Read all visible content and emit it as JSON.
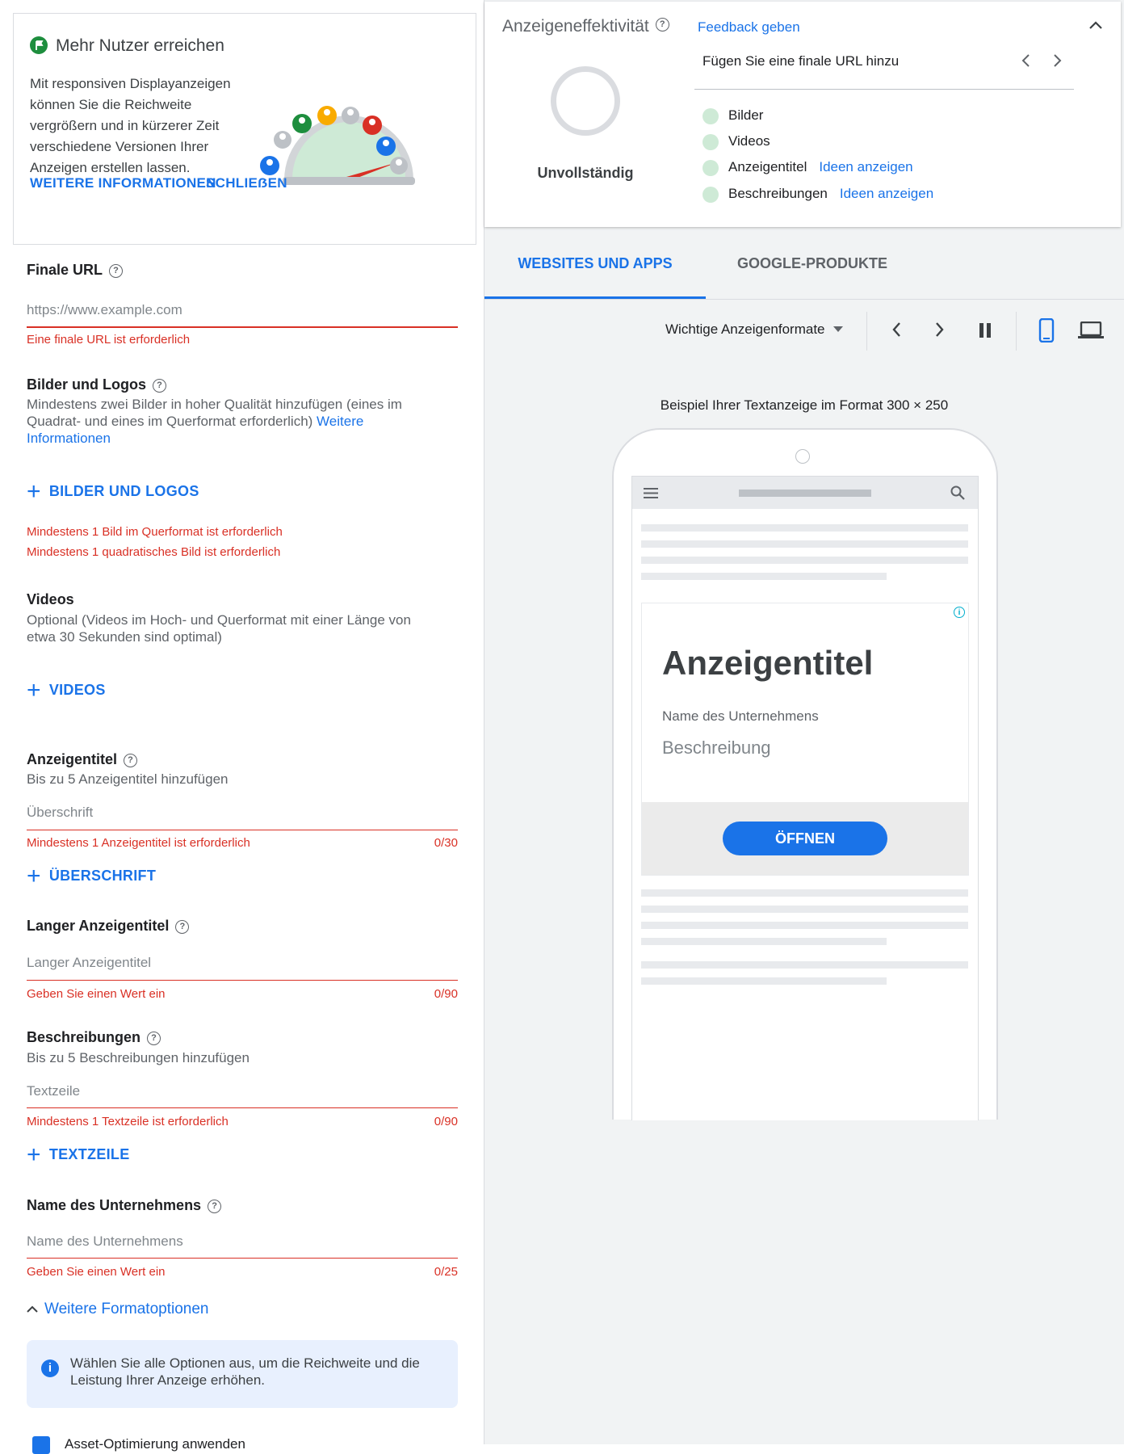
{
  "promo": {
    "title": "Mehr Nutzer erreichen",
    "text": "Mit responsiven Displayanzeigen können Sie die Reichweite vergrößern und in kürzerer Zeit verschiedene Versionen Ihrer Anzeigen erstellen lassen.",
    "more_info": "WEITERE INFORMATIONEN",
    "close": "SCHLIEẞEN"
  },
  "final_url": {
    "label": "Finale URL",
    "placeholder": "https://www.example.com",
    "error": "Eine finale URL ist erforderlich"
  },
  "images": {
    "label": "Bilder und Logos",
    "desc": "Mindestens zwei Bilder in hoher Qualität hinzufügen (eines im Quadrat- und eines im Querformat erforderlich)",
    "desc_link": "Weitere Informationen",
    "add": "BILDER UND LOGOS",
    "error1": "Mindestens 1 Bild im Querformat ist erforderlich",
    "error2": "Mindestens 1 quadratisches Bild ist erforderlich"
  },
  "videos": {
    "label": "Videos",
    "desc": "Optional (Videos im Hoch- und Querformat mit einer Länge von etwa 30 Sekunden sind optimal)",
    "add": "VIDEOS"
  },
  "headlines": {
    "label": "Anzeigentitel",
    "desc": "Bis zu 5 Anzeigentitel hinzufügen",
    "placeholder": "Überschrift",
    "error": "Mindestens 1 Anzeigentitel ist erforderlich",
    "counter": "0/30",
    "add": "ÜBERSCHRIFT"
  },
  "long_headline": {
    "label": "Langer Anzeigentitel",
    "placeholder": "Langer Anzeigentitel",
    "error": "Geben Sie einen Wert ein",
    "counter": "0/90"
  },
  "descriptions": {
    "label": "Beschreibungen",
    "desc": "Bis zu 5 Beschreibungen hinzufügen",
    "placeholder": "Textzeile",
    "error": "Mindestens 1 Textzeile ist erforderlich",
    "counter": "0/90",
    "add": "TEXTZEILE"
  },
  "business": {
    "label": "Name des Unternehmens",
    "placeholder": "Name des Unternehmens",
    "error": "Geben Sie einen Wert ein",
    "counter": "0/25"
  },
  "more_formats": {
    "label": "Weitere Formatoptionen",
    "info": "Wählen Sie alle Optionen aus, um die Reichweite und die Leistung Ihrer Anzeige erhöhen.",
    "checkbox_label": "Asset-Optimierung anwenden"
  },
  "effectiveness": {
    "title": "Anzeigeneffektivität",
    "feedback": "Feedback geben",
    "status": "Unvollständig",
    "tip": "Fügen Sie eine finale URL hinzu",
    "items": [
      {
        "label": "Bilder",
        "link": ""
      },
      {
        "label": "Videos",
        "link": ""
      },
      {
        "label": "Anzeigentitel",
        "link": "Ideen anzeigen"
      },
      {
        "label": "Beschreibungen",
        "link": "Ideen anzeigen"
      }
    ]
  },
  "tabs": [
    "WEBSITES UND APPS",
    "GOOGLE-PRODUKTE"
  ],
  "toolbar": {
    "format": "Wichtige Anzeigenformate"
  },
  "preview": {
    "caption": "Beispiel Ihrer Textanzeige im Format 300 × 250",
    "ad_title": "Anzeigentitel",
    "business": "Name des Unternehmens",
    "description": "Beschreibung",
    "cta": "ÖFFNEN"
  },
  "colors": {
    "accent": "#1a73e8",
    "error": "#d93025",
    "cta": "#1a73e8"
  }
}
